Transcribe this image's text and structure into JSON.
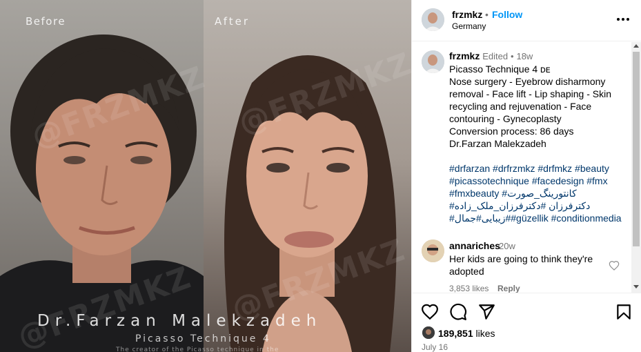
{
  "media": {
    "before_label": "Before",
    "after_label": "After",
    "watermark": "@FRZMKZ",
    "doctor_name": "Dr.Farzan Malekzadeh",
    "technique": "Picasso Technique 4",
    "creator_line": "The creator of the Picasso technique in the"
  },
  "header": {
    "username": "frzmkz",
    "dot": "•",
    "follow_label": "Follow",
    "location": "Germany",
    "more_icon": "more-horizontal-icon"
  },
  "caption": {
    "username": "frzmkz",
    "edited": "Edited",
    "dot": "•",
    "time": "18w",
    "lines": [
      "Picasso Technique 4 ᴅᴇ",
      "Nose surgery - Eyebrow disharmony",
      "removal - Face lift - Lip shaping - Skin",
      "recycling and rejuvenation - Face",
      "contouring - Gynecoplasty",
      "Conversion process: 86 days",
      "Dr.Farzan Malekzadeh"
    ],
    "hashtag_lines": [
      "#drfarzan #drfrzmkz #drfmkz #beauty",
      "#picassotechnique #facedesign #fmx",
      "#fmxbeauty #کانتورینگ_صورت",
      "#دکترفرزان #دکترفرزان_ملک_زاده",
      "#زیبایی#جمال##güzellik #conditionmedia"
    ]
  },
  "comment": {
    "username": "annariches",
    "time": "20w",
    "text": "Her kids are going to think they're adopted",
    "likes": "3,853 likes",
    "reply": "Reply"
  },
  "actions": {
    "likes_count": "189,851",
    "likes_word": "likes",
    "date": "July 16"
  },
  "colors": {
    "accent": "#0095f6",
    "hashtag": "#00376b",
    "secondary_text": "#737373"
  }
}
